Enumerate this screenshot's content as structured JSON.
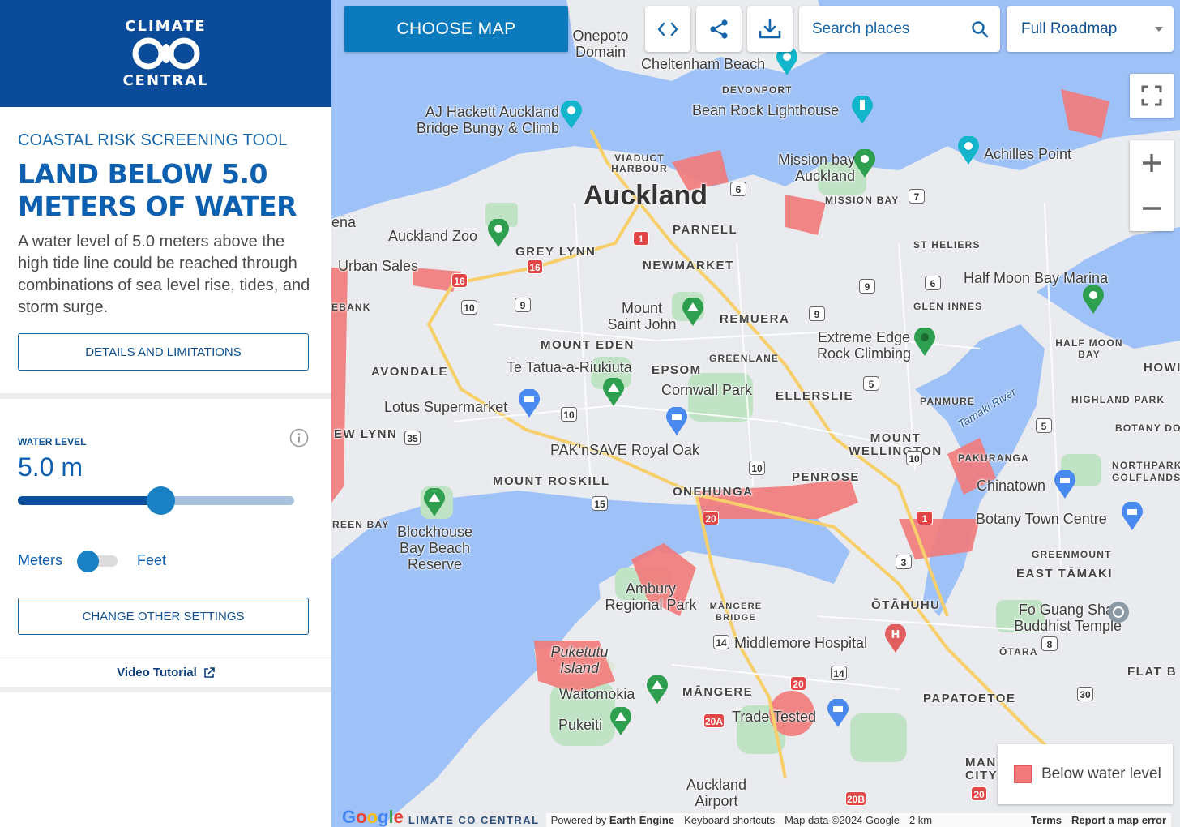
{
  "sidebar": {
    "logo": {
      "top": "CLIMATE",
      "bottom": "CENTRAL"
    },
    "tool_label": "COASTAL RISK SCREENING TOOL",
    "heading": "LAND BELOW 5.0 METERS OF WATER",
    "description": "A water level of 5.0 meters above the high tide line could be reached through combinations of sea level rise, tides, and storm surge.",
    "details_button": "DETAILS AND LIMITATIONS",
    "water_level_label": "WATER LEVEL",
    "water_level_value": "5.0 m",
    "slider_fraction": 0.5,
    "unit_meters": "Meters",
    "unit_feet": "Feet",
    "unit_toggle_on": false,
    "change_settings_button": "CHANGE OTHER SETTINGS",
    "video_tutorial": "Video Tutorial"
  },
  "map_controls": {
    "choose_map": "CHOOSE MAP",
    "embed_icon": "code-icon",
    "share_icon": "share-icon",
    "download_icon": "download-icon",
    "search_placeholder": "Search places",
    "map_type": "Full Roadmap",
    "legend": "Below water level",
    "legend_color": "#f27a7a"
  },
  "map_labels": {
    "city": "Auckland",
    "suburbs": [
      "PARNELL",
      "GREY LYNN",
      "NEWMARKET",
      "REMUERA",
      "MOUNT EDEN",
      "AVONDALE",
      "EPSOM",
      "ELLERSLIE",
      "MOUNT WELLINGTON",
      "PENROSE",
      "MOUNT ROSKILL",
      "ONEHUNGA",
      "ŌTĀHUHU",
      "MĀNGERE",
      "PAPATOETOE",
      "EAST TĀMAKI",
      "HOWIC",
      "FLAT B",
      "MAN CITY",
      "EW LYNN",
      "ena",
      "EBANK",
      "REEN BAY"
    ],
    "small": [
      "VIADUCT HARBOUR",
      "DEVONPORT",
      "MISSION BAY",
      "ST HELIERS",
      "GLEN INNES",
      "GREENLANE",
      "PANMURE",
      "PAKURANGA",
      "HALF MOON BAY",
      "HIGHLAND PARK",
      "BOTANY DOWN",
      "NORTHPARK GOLFLANDS",
      "GREENMOUNT",
      "ŌTARA",
      "MĀNGERE BRIDGE"
    ],
    "pois": [
      "Onepoto Domain",
      "Cheltenham Beach",
      "Bean Rock Lighthouse",
      "AJ Hackett Auckland Bridge Bungy & Climb",
      "Mission bay Auckland",
      "Achilles Point",
      "Auckland Zoo",
      "Urban Sales",
      "Half Moon Bay Marina",
      "Mount Saint John",
      "Extreme Edge Rock Climbing",
      "Te Tatua-a-Riukiuta",
      "Cornwall Park",
      "Lotus Supermarket",
      "PAK'nSAVE Royal Oak",
      "Chinatown",
      "Botany Town Centre",
      "Blockhouse Bay Beach Reserve",
      "Ambury Regional Park",
      "Fo Guang Shan Buddhist Temple",
      "Middlemore Hospital",
      "Puketutu Island",
      "Waitomokia",
      "Pukeiti",
      "Trade Tested",
      "Auckland Airport"
    ],
    "water": "Tamaki River"
  },
  "attribution": {
    "google": "Google",
    "climate_central": "LIMATE CO CENTRAL",
    "powered": "Powered by",
    "engine": "Earth Engine",
    "shortcuts": "Keyboard shortcuts",
    "mapdata": "Map data ©2024 Google",
    "scale": "2 km",
    "terms": "Terms",
    "report": "Report a map error"
  }
}
